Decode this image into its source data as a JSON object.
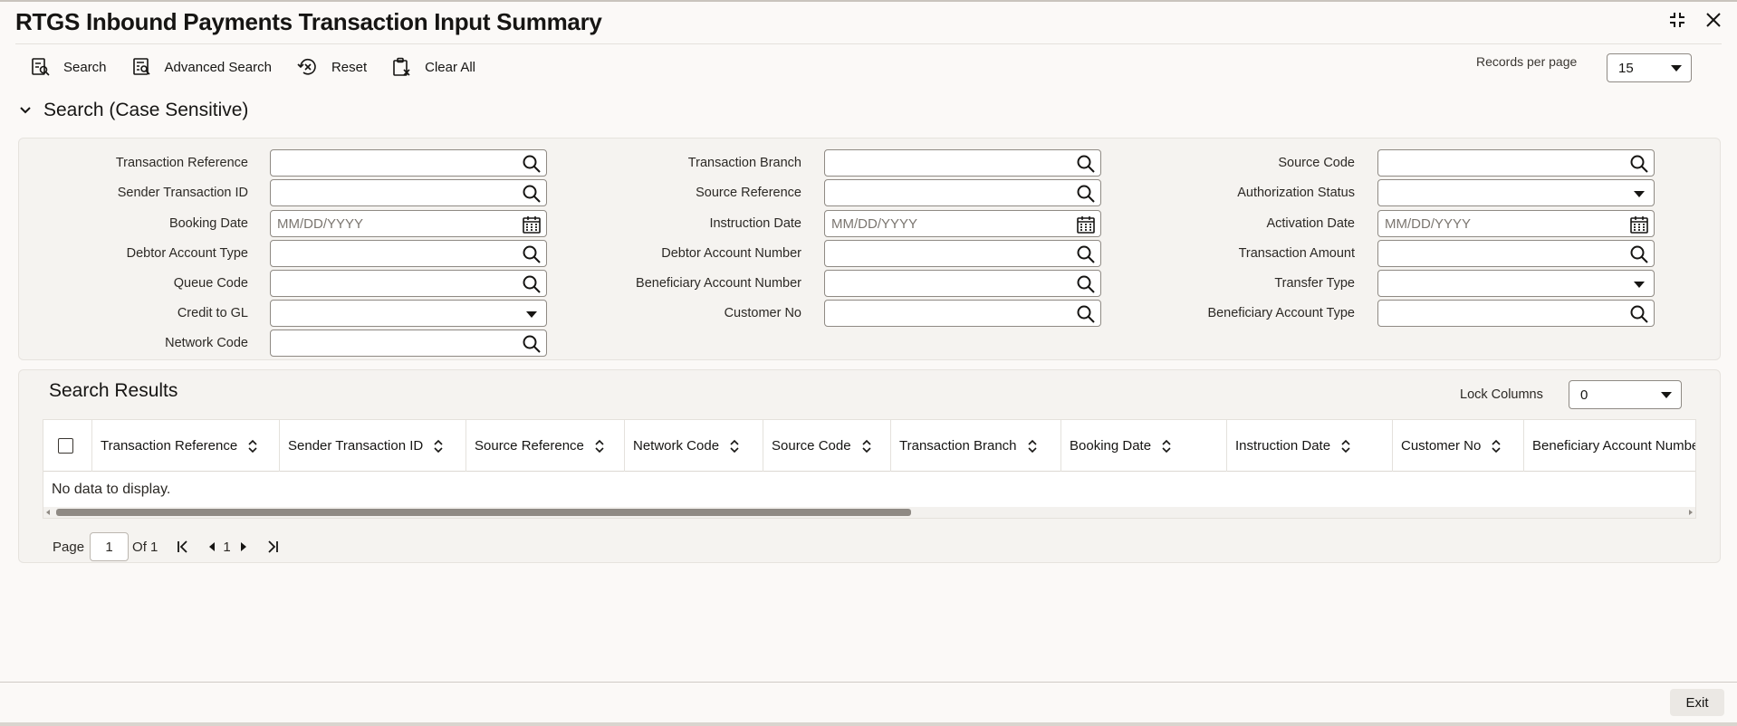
{
  "title": "RTGS Inbound Payments Transaction Input Summary",
  "toolbar": {
    "search": "Search",
    "advanced_search": "Advanced Search",
    "reset": "Reset",
    "clear_all": "Clear All"
  },
  "records_per_page": {
    "label": "Records per page",
    "value": "15"
  },
  "search_section": {
    "title": "Search (Case Sensitive)"
  },
  "fields": {
    "transaction_reference": {
      "label": "Transaction Reference",
      "value": ""
    },
    "sender_transaction_id": {
      "label": "Sender Transaction ID",
      "value": ""
    },
    "booking_date": {
      "label": "Booking Date",
      "placeholder": "MM/DD/YYYY"
    },
    "debtor_account_type": {
      "label": "Debtor Account Type",
      "value": ""
    },
    "queue_code": {
      "label": "Queue Code",
      "value": ""
    },
    "credit_to_gl": {
      "label": "Credit to GL",
      "value": ""
    },
    "network_code": {
      "label": "Network Code",
      "value": ""
    },
    "transaction_branch": {
      "label": "Transaction Branch",
      "value": ""
    },
    "source_reference": {
      "label": "Source Reference",
      "value": ""
    },
    "instruction_date": {
      "label": "Instruction Date",
      "placeholder": "MM/DD/YYYY"
    },
    "debtor_account_number": {
      "label": "Debtor Account Number",
      "value": ""
    },
    "beneficiary_account_number": {
      "label": "Beneficiary Account Number",
      "value": ""
    },
    "customer_no": {
      "label": "Customer No",
      "value": ""
    },
    "source_code": {
      "label": "Source Code",
      "value": ""
    },
    "authorization_status": {
      "label": "Authorization Status",
      "value": ""
    },
    "activation_date": {
      "label": "Activation Date",
      "placeholder": "MM/DD/YYYY"
    },
    "transaction_amount": {
      "label": "Transaction Amount",
      "value": ""
    },
    "transfer_type": {
      "label": "Transfer Type",
      "value": ""
    },
    "beneficiary_account_type": {
      "label": "Beneficiary Account Type",
      "value": ""
    }
  },
  "results": {
    "title": "Search Results",
    "lock_columns": {
      "label": "Lock Columns",
      "value": "0"
    },
    "columns": [
      "Transaction Reference",
      "Sender Transaction ID",
      "Source Reference",
      "Network Code",
      "Source Code",
      "Transaction Branch",
      "Booking Date",
      "Instruction Date",
      "Customer No",
      "Beneficiary Account Numbe"
    ],
    "empty_text": "No data to display."
  },
  "pagination": {
    "page_label": "Page",
    "current_page": "1",
    "of_label": "Of 1",
    "page_number": "1"
  },
  "footer": {
    "exit": "Exit"
  },
  "icons": {
    "search": "search-icon",
    "advanced_search": "advanced-search-icon",
    "reset": "reset-icon",
    "clear_all": "clear-all-icon",
    "calendar": "calendar-icon",
    "maximize": "maximize-icon",
    "close": "close-icon"
  }
}
